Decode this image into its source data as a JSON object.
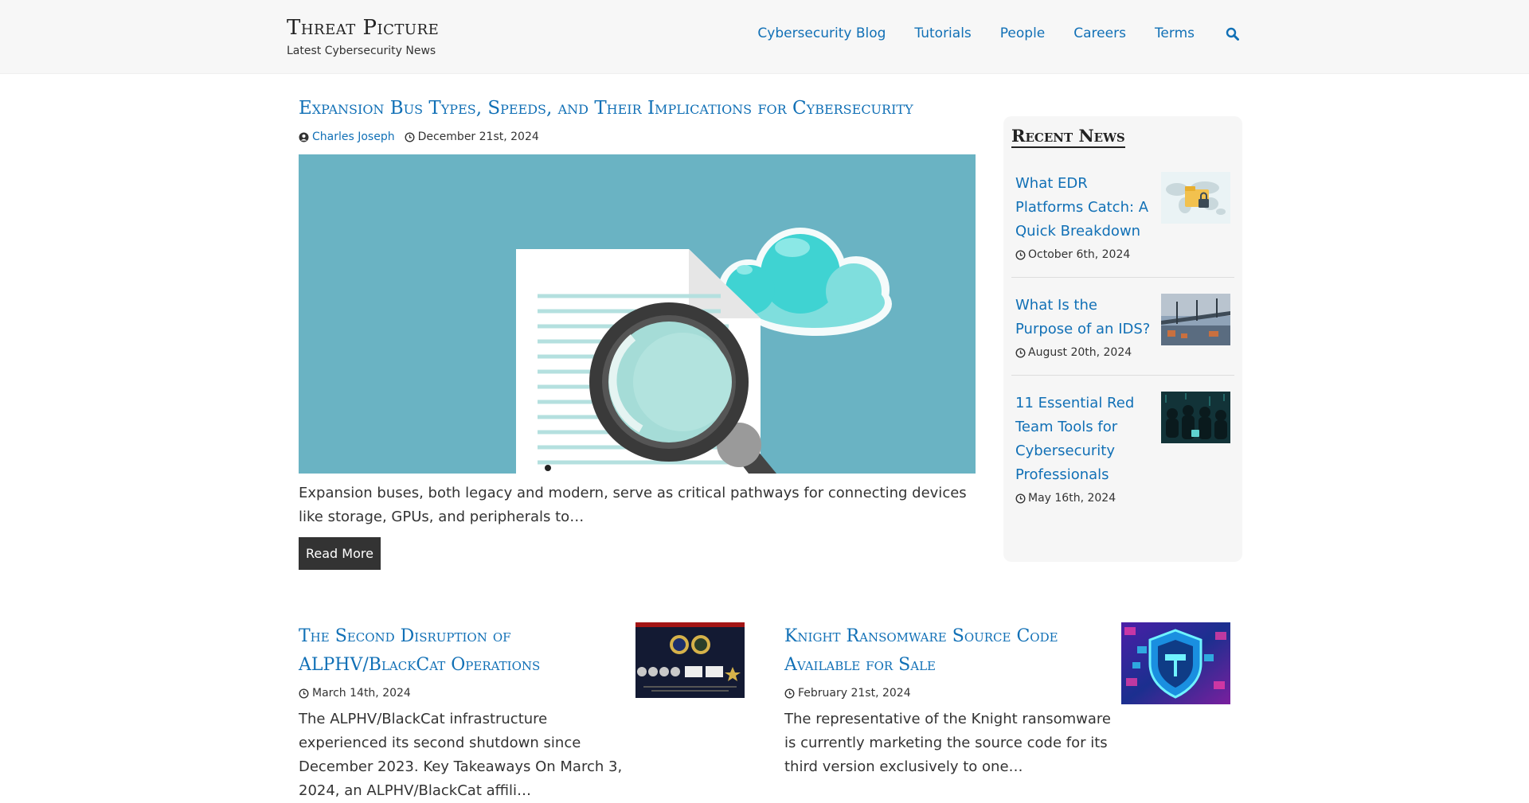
{
  "header": {
    "site_title": "Threat Picture",
    "tagline": "Latest Cybersecurity News",
    "nav": [
      {
        "label": "Cybersecurity Blog"
      },
      {
        "label": "Tutorials"
      },
      {
        "label": "People"
      },
      {
        "label": "Careers"
      },
      {
        "label": "Terms"
      }
    ],
    "search_icon": "search-icon"
  },
  "featured": {
    "title": "Expansion Bus Types, Speeds, and Their Implications for Cybersecurity",
    "author": "Charles Joseph",
    "date": "December 21st, 2024",
    "image": "document-magnifier-cloud-illustration",
    "excerpt": "Expansion buses, both legacy and modern, serve as critical pathways for connecting devices like storage, GPUs, and peripherals to…",
    "read_more": "Read More"
  },
  "sidebar": {
    "title": "Recent News",
    "items": [
      {
        "title": "What EDR Platforms Catch: A Quick Breakdown",
        "date": "October 6th, 2024",
        "thumb": "world-map-folder-lock-image"
      },
      {
        "title": "What Is the Purpose of an IDS?",
        "date": "August 20th, 2024",
        "thumb": "harbor-bridge-image"
      },
      {
        "title": "11 Essential Red Team Tools for Cybersecurity Professionals",
        "date": "May 16th, 2024",
        "thumb": "hooded-figures-image"
      }
    ]
  },
  "posts": [
    {
      "title": "The Second Disruption of ALPHV/BlackCat Operations",
      "date": "March 14th, 2024",
      "excerpt": "The ALPHV/BlackCat infrastructure experienced its second shutdown since December 2023. Key Takeaways On March 3, 2024, an ALPHV/BlackCat affili…",
      "thumb": "seizure-banner-image"
    },
    {
      "title": "Knight Ransomware Source Code Available for Sale",
      "date": "February 21st, 2024",
      "excerpt": "The representative of the Knight ransomware is currently marketing the source code for its third version exclusively to one…",
      "thumb": "knight-shield-neon-image"
    }
  ],
  "colors": {
    "link": "#1170b6",
    "button_bg": "#333333",
    "header_bg": "#f7f7f7",
    "sidebar_bg": "#f6f6f6",
    "hero_bg": "#6ab3c3"
  }
}
